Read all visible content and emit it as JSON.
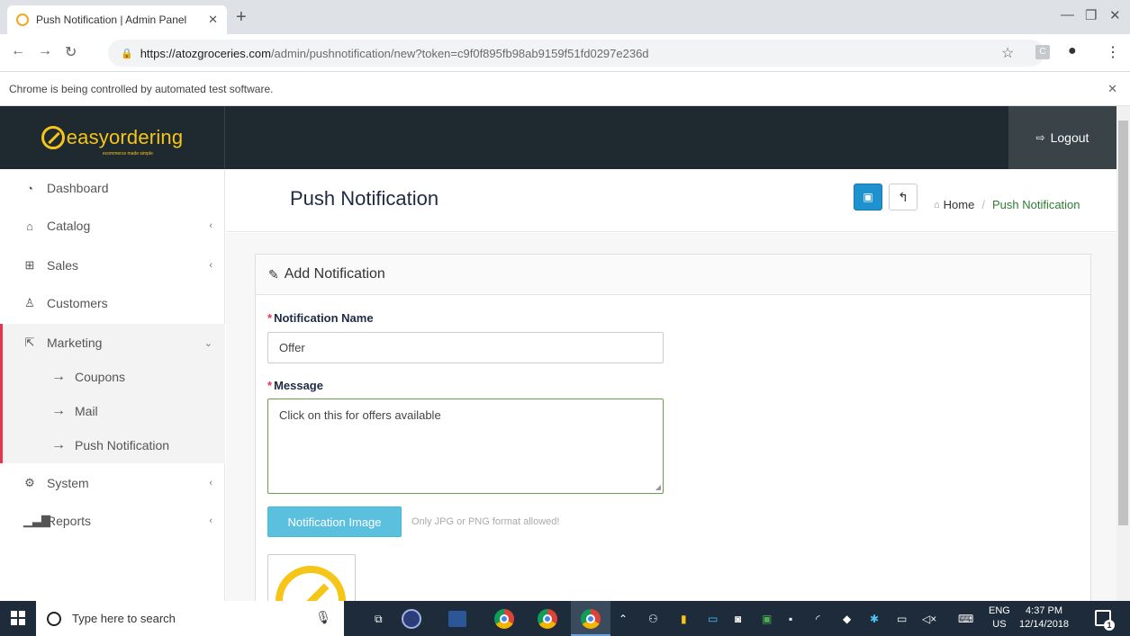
{
  "browser": {
    "tab_title": "Push Notification | Admin Panel",
    "url_host": "https://atozgroceries.com",
    "url_path": "/admin/pushnotification/new?token=c9f0f895fb98ab9159f51fd0297e236d",
    "automation_notice": "Chrome is being controlled by automated test software."
  },
  "header": {
    "logo_text": "easyordering",
    "logo_tagline": "ecommerce made simple",
    "logout_label": "Logout"
  },
  "sidebar": {
    "items": [
      {
        "label": "Dashboard",
        "icon": "dashboard-icon"
      },
      {
        "label": "Catalog",
        "icon": "tag-icon"
      },
      {
        "label": "Sales",
        "icon": "cart-icon"
      },
      {
        "label": "Customers",
        "icon": "user-icon"
      },
      {
        "label": "Marketing",
        "icon": "share-icon"
      },
      {
        "label": "System",
        "icon": "gear-icon"
      },
      {
        "label": "Reports",
        "icon": "bar-chart-icon"
      }
    ],
    "marketing_sub": [
      {
        "label": "Coupons"
      },
      {
        "label": "Mail"
      },
      {
        "label": "Push Notification"
      }
    ]
  },
  "page": {
    "title": "Push Notification",
    "breadcrumb_home": "Home",
    "breadcrumb_sep": "/",
    "breadcrumb_current": "Push Notification"
  },
  "form": {
    "panel_title": "Add Notification",
    "name_label": "Notification Name",
    "name_value": "Offer",
    "message_label": "Message",
    "message_value": "Click on this for offers available",
    "image_button": "Notification Image",
    "image_help": "Only JPG or PNG format allowed!"
  },
  "taskbar": {
    "search_placeholder": "Type here to search",
    "lang_top": "ENG",
    "lang_bottom": "US",
    "time": "4:37 PM",
    "date": "12/14/2018",
    "notification_count": "1"
  },
  "colors": {
    "header_bg": "#1f2a30",
    "accent_red": "#e8344e",
    "brand_yellow": "#f5c518",
    "save_blue": "#1e91cf",
    "info_blue": "#5bc0de"
  }
}
